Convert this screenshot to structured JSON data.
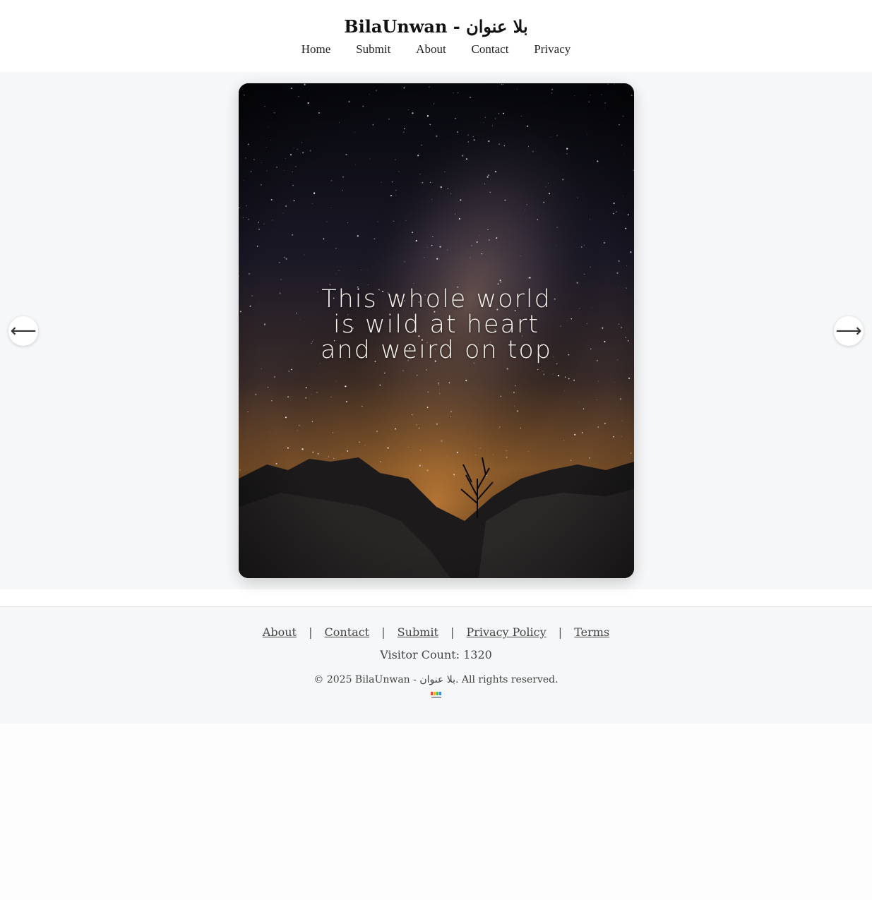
{
  "header": {
    "title": "BilaUnwan - بلا عنوان",
    "nav": [
      "Home",
      "Submit",
      "About",
      "Contact",
      "Privacy"
    ]
  },
  "viewer": {
    "quote": "This whole world is wild at heart and weird on top",
    "prev_icon": "arrow-left-icon",
    "next_icon": "arrow-right-icon",
    "prev_glyph": "⟵",
    "next_glyph": "⟶"
  },
  "footer": {
    "links": [
      "About",
      "Contact",
      "Submit",
      "Privacy Policy",
      "Terms"
    ],
    "separator": "|",
    "visitor_count": "Visitor Count: 1320",
    "copyright": "© 2025 BilaUnwan - بلا عنوان. All rights reserved."
  },
  "colors": {
    "page_bg": "#f6f7f8",
    "text": "#222222",
    "link": "#444444"
  }
}
